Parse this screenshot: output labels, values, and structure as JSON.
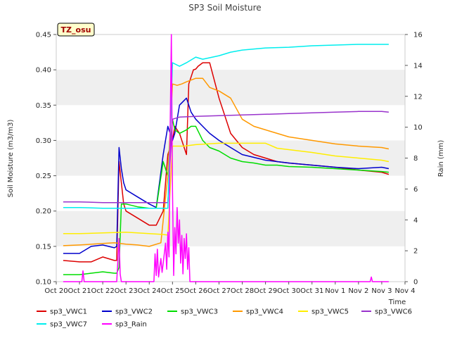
{
  "chart_data": {
    "type": "line",
    "title": "SP3 Soil Moisture",
    "station_badge": "TZ_osu",
    "xlabel": "Time",
    "ylabel": "Soil Moisture (m3/m3)",
    "y2label": "Rain (mm)",
    "x_ticks": [
      "Oct 20",
      "Oct 21",
      "Oct 22",
      "Oct 23",
      "Oct 24",
      "Oct 25",
      "Oct 26",
      "Oct 27",
      "Oct 28",
      "Oct 29",
      "Oct 30",
      "Oct 31",
      "Nov 1",
      "Nov 2",
      "Nov 3",
      "Nov 4"
    ],
    "y_ticks": [
      "0.10",
      "0.15",
      "0.20",
      "0.25",
      "0.30",
      "0.35",
      "0.40",
      "0.45"
    ],
    "y2_ticks": [
      "0",
      "2",
      "4",
      "6",
      "8",
      "10",
      "12",
      "14",
      "16"
    ],
    "xlim": [
      0,
      15
    ],
    "ylim": [
      0.1,
      0.45
    ],
    "y2lim": [
      0,
      16
    ],
    "x_unit": "days since Oct 20",
    "grid": "horizontal bands",
    "legend": "bottom",
    "series": [
      {
        "name": "sp3_VWC1",
        "color": "#dd0000",
        "axis": "left",
        "x": [
          0.3,
          1,
          1.5,
          2,
          2.5,
          2.6,
          2.7,
          2.8,
          2.9,
          3,
          3.5,
          4,
          4.3,
          4.6,
          4.8,
          5,
          5.1,
          5.3,
          5.6,
          5.7,
          5.9,
          6,
          6.1,
          6.3,
          6.6,
          7,
          7.5,
          8,
          8.5,
          9,
          9.5,
          10,
          11,
          12,
          13,
          14,
          14.3
        ],
        "y": [
          0.13,
          0.128,
          0.128,
          0.135,
          0.13,
          0.13,
          0.27,
          0.24,
          0.21,
          0.2,
          0.19,
          0.18,
          0.18,
          0.2,
          0.28,
          0.3,
          0.32,
          0.31,
          0.28,
          0.38,
          0.4,
          0.401,
          0.405,
          0.41,
          0.41,
          0.36,
          0.31,
          0.29,
          0.28,
          0.275,
          0.27,
          0.268,
          0.265,
          0.262,
          0.258,
          0.255,
          0.252
        ]
      },
      {
        "name": "sp3_VWC2",
        "color": "#0000cc",
        "axis": "left",
        "x": [
          0.3,
          1,
          1.5,
          2,
          2.5,
          2.6,
          2.7,
          2.8,
          2.9,
          3,
          3.5,
          4,
          4.3,
          4.6,
          4.8,
          5,
          5.1,
          5.3,
          5.6,
          5.8,
          6,
          6.3,
          6.6,
          7,
          7.5,
          8,
          8.5,
          9,
          9.5,
          10,
          11,
          12,
          13,
          14,
          14.3
        ],
        "y": [
          0.14,
          0.14,
          0.15,
          0.152,
          0.148,
          0.15,
          0.29,
          0.26,
          0.24,
          0.23,
          0.22,
          0.21,
          0.205,
          0.28,
          0.32,
          0.3,
          0.31,
          0.35,
          0.36,
          0.34,
          0.33,
          0.32,
          0.31,
          0.3,
          0.29,
          0.28,
          0.276,
          0.272,
          0.27,
          0.268,
          0.265,
          0.262,
          0.26,
          0.262,
          0.26
        ]
      },
      {
        "name": "sp3_VWC3",
        "color": "#00dd00",
        "axis": "left",
        "x": [
          0.3,
          1,
          1.5,
          2,
          2.5,
          2.6,
          2.7,
          2.8,
          3,
          3.5,
          4,
          4.3,
          4.6,
          4.8,
          5,
          5.1,
          5.3,
          5.6,
          5.8,
          6,
          6.3,
          6.6,
          7,
          7.5,
          8,
          8.5,
          9,
          9.5,
          10,
          11,
          12,
          13,
          14,
          14.3
        ],
        "y": [
          0.11,
          0.11,
          0.112,
          0.114,
          0.112,
          0.112,
          0.12,
          0.21,
          0.21,
          0.206,
          0.204,
          0.204,
          0.27,
          0.25,
          0.33,
          0.315,
          0.31,
          0.315,
          0.32,
          0.32,
          0.3,
          0.29,
          0.285,
          0.275,
          0.27,
          0.268,
          0.265,
          0.265,
          0.263,
          0.262,
          0.26,
          0.258,
          0.256,
          0.255
        ]
      },
      {
        "name": "sp3_VWC4",
        "color": "#ff9900",
        "axis": "left",
        "x": [
          0.3,
          1,
          2,
          2.5,
          3,
          3.5,
          4,
          4.5,
          4.8,
          5,
          5.2,
          5.4,
          5.6,
          6,
          6.3,
          6.6,
          7,
          7.5,
          8,
          8.5,
          9,
          9.5,
          10,
          11,
          12,
          13,
          14,
          14.3
        ],
        "y": [
          0.151,
          0.152,
          0.154,
          0.155,
          0.153,
          0.152,
          0.15,
          0.155,
          0.25,
          0.38,
          0.378,
          0.38,
          0.383,
          0.388,
          0.388,
          0.375,
          0.37,
          0.36,
          0.33,
          0.32,
          0.315,
          0.31,
          0.305,
          0.3,
          0.295,
          0.292,
          0.29,
          0.288
        ]
      },
      {
        "name": "sp3_VWC5",
        "color": "#ffee00",
        "axis": "left",
        "x": [
          0.3,
          1,
          2,
          3,
          4,
          4.5,
          4.8,
          5,
          5.5,
          6,
          7,
          8,
          8.5,
          9,
          9.5,
          10,
          11,
          12,
          13,
          14,
          14.3
        ],
        "y": [
          0.168,
          0.168,
          0.169,
          0.17,
          0.168,
          0.167,
          0.166,
          0.292,
          0.292,
          0.294,
          0.296,
          0.296,
          0.296,
          0.296,
          0.289,
          0.287,
          0.283,
          0.278,
          0.275,
          0.272,
          0.27
        ]
      },
      {
        "name": "sp3_VWC6",
        "color": "#9933cc",
        "axis": "left",
        "x": [
          0.3,
          1,
          2,
          3,
          4,
          4.8,
          5,
          5.3,
          6,
          7,
          8,
          9,
          10,
          11,
          12,
          13,
          14,
          14.3
        ],
        "y": [
          0.213,
          0.213,
          0.212,
          0.212,
          0.212,
          0.212,
          0.33,
          0.333,
          0.334,
          0.335,
          0.336,
          0.337,
          0.338,
          0.339,
          0.34,
          0.341,
          0.341,
          0.34
        ]
      },
      {
        "name": "sp3_VWC7",
        "color": "#00eeee",
        "axis": "left",
        "x": [
          0.3,
          1,
          2,
          3,
          4,
          4.8,
          5,
          5.3,
          5.6,
          6,
          6.3,
          7,
          7.5,
          8,
          9,
          10,
          11,
          12,
          13,
          14,
          14.3
        ],
        "y": [
          0.205,
          0.205,
          0.204,
          0.204,
          0.204,
          0.204,
          0.41,
          0.405,
          0.41,
          0.418,
          0.415,
          0.42,
          0.425,
          0.428,
          0.431,
          0.432,
          0.434,
          0.435,
          0.436,
          0.436,
          0.436
        ]
      },
      {
        "name": "sp3_Rain",
        "color": "#ff00ff",
        "axis": "right",
        "x": [
          0.3,
          1.1,
          1.15,
          1.2,
          2.6,
          2.7,
          2.75,
          2.8,
          4.2,
          4.25,
          4.3,
          4.35,
          4.4,
          4.5,
          4.55,
          4.6,
          4.7,
          4.75,
          4.8,
          4.85,
          4.9,
          4.95,
          5.0,
          5.05,
          5.1,
          5.15,
          5.2,
          5.25,
          5.3,
          5.35,
          5.4,
          5.45,
          5.5,
          5.55,
          5.6,
          5.65,
          5.7,
          5.75,
          13.5,
          13.55,
          13.6,
          14.3
        ],
        "y": [
          0,
          0,
          0.7,
          0,
          0,
          2.8,
          0.5,
          0,
          0,
          1.8,
          0.4,
          2.1,
          0.3,
          1.5,
          0.6,
          1.2,
          2.5,
          0.8,
          3.2,
          1.6,
          10,
          16,
          6,
          0.4,
          3.5,
          1.8,
          4.8,
          2.5,
          4,
          1.2,
          3,
          0.5,
          2.8,
          1.5,
          3.1,
          0.8,
          2.2,
          0,
          0,
          0.3,
          0,
          0
        ]
      }
    ]
  }
}
